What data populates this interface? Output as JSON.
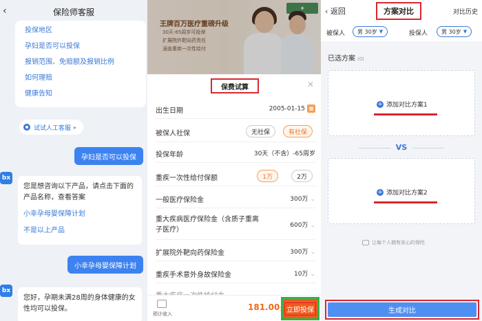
{
  "chat": {
    "title": "保险师客服",
    "faq_items": [
      "投保地区",
      "孕妇是否可以投保",
      "报销范围、免赔额及报销比例",
      "如何理赔",
      "健康告知"
    ],
    "human_service": "试试人工客服",
    "user_msg_1": "孕妇是否可以投保",
    "bot_reply_1": "您是想咨询以下产品，请点击下面的产品名称，查看答案",
    "bot_option_1": "小幸孕母婴保障计划",
    "bot_option_2": "不是以上产品",
    "user_msg_2": "小幸孕母婴保障计划",
    "bot_reply_2": "您好，孕期未满28周的身体健康的女性均可以投保。",
    "bot_avatar_text": "bx"
  },
  "calc": {
    "banner": {
      "title": "王牌百万医疗重磅升级",
      "bullets": [
        "30天-65周岁可投保",
        "扩展院外靶向药责任",
        "涵盖重疾一次性给付"
      ]
    },
    "sheet_title": "保费试算",
    "rows": [
      {
        "label": "出生日期",
        "value": "2005-01-15"
      },
      {
        "label": "被保人社保",
        "options": [
          "无社保",
          "有社保"
        ],
        "selected": "有社保"
      },
      {
        "label": "投保年龄",
        "value": "30天（不含）-65周岁"
      },
      {
        "label": "重疾一次性给付保额",
        "options": [
          "1万",
          "2万"
        ],
        "selected": "1万"
      },
      {
        "label": "一般医疗保险金",
        "value": "300万"
      },
      {
        "label": "重大疾病医疗保险金（含质子重离子医疗）",
        "value": "600万"
      },
      {
        "label": "扩展院外靶向药保险金",
        "value": "300万"
      },
      {
        "label": "重疾手术意外身故保险金",
        "value": "10万"
      },
      {
        "label": "重大疾病一次性给付金",
        "value": ""
      }
    ],
    "estimate_label": "预计收入",
    "price": "181.00",
    "price_unit": "元",
    "buy_label": "立即投保",
    "colors": {
      "accent": "#ef5b1e",
      "highlight": "#33b24a"
    }
  },
  "compare": {
    "back_label": "返回",
    "title": "方案对比",
    "history": "对比历史",
    "insured_label": "被保人",
    "insured_value": "男 30岁",
    "holder_label": "投保人",
    "holder_value": "男 30岁",
    "selected_label": "已选方案",
    "selected_count": "(0)",
    "add_plan_1": "添加对比方案1",
    "add_plan_2": "添加对比方案2",
    "vs": "VS",
    "slogan": "让每个人拥有安心的保险",
    "generate": "生成对比"
  }
}
